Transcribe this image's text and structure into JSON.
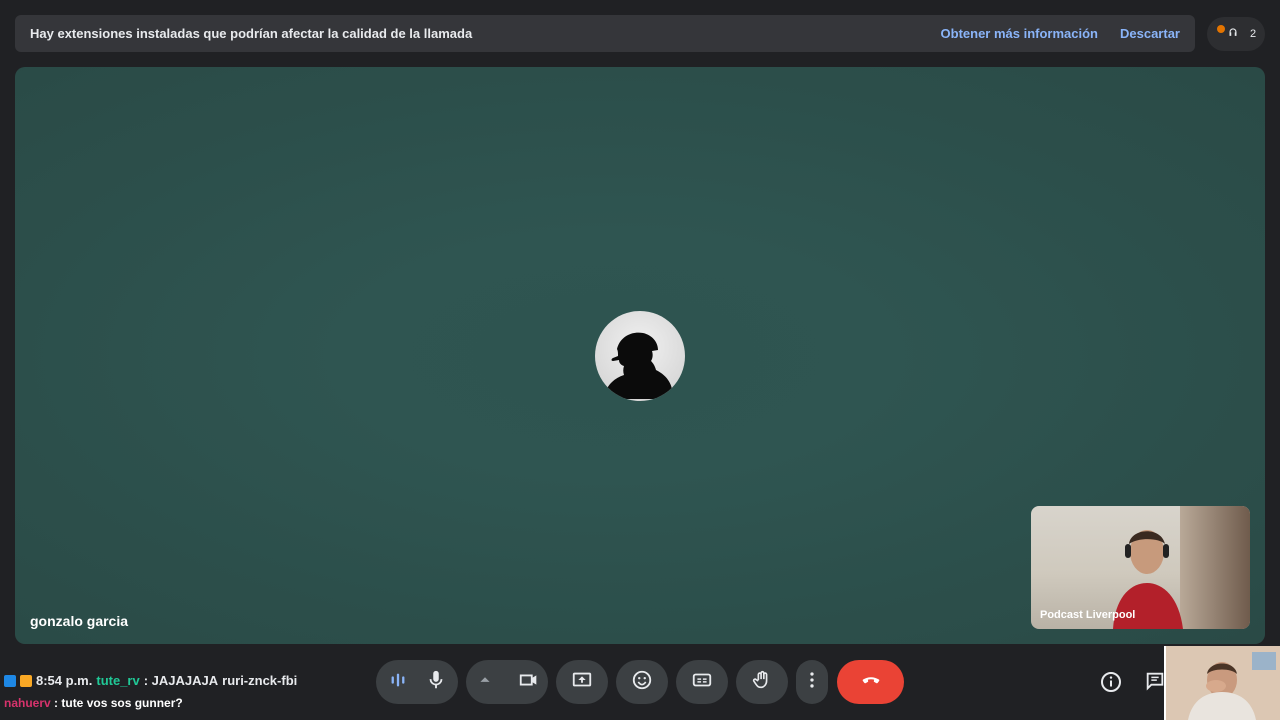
{
  "banner": {
    "message": "Hay extensiones instaladas que podrían afectar la calidad de la llamada",
    "learn_more": "Obtener más información",
    "dismiss": "Descartar"
  },
  "people": {
    "count": "2",
    "icon": "people-icon"
  },
  "main_tile": {
    "name": "gonzalo garcia",
    "avatar": "silhouette-avatar"
  },
  "self_tile": {
    "name": "Podcast Liverpool"
  },
  "chat_overlay": {
    "line1": {
      "time": "8:54 p.m.",
      "user": "tute_rv",
      "message": ": JAJAJAJA",
      "meeting_code": "ruri-znck-fbi"
    },
    "line2": {
      "user": "nahuerv",
      "message": ": tute vos sos gunner?"
    }
  },
  "controls": [
    {
      "name": "audio-levels-icon"
    },
    {
      "name": "microphone-icon"
    },
    {
      "name": "chevron-up-icon"
    },
    {
      "name": "camera-icon"
    },
    {
      "name": "present-screen-icon"
    },
    {
      "name": "emoji-icon"
    },
    {
      "name": "captions-icon"
    },
    {
      "name": "raise-hand-icon"
    },
    {
      "name": "more-options-icon"
    },
    {
      "name": "hang-up-icon"
    }
  ],
  "colors": {
    "accent": "#8ab4f8",
    "hangup": "#ea4335",
    "background": "#202124",
    "tile": "#2e5450"
  }
}
